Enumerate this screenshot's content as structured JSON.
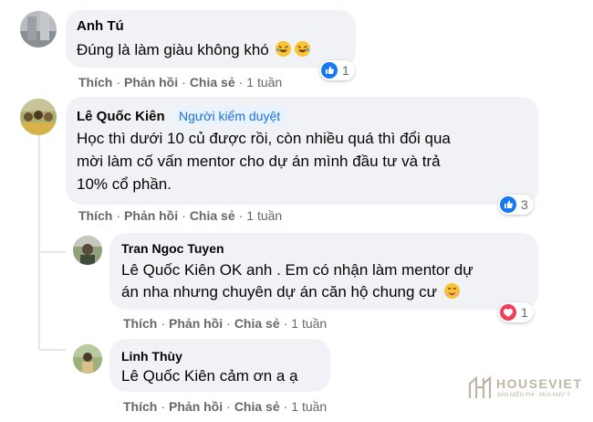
{
  "comments": [
    {
      "author": "Anh Tú",
      "text": "Đúng là làm giàu không khó",
      "reaction_count": "1",
      "actions": {
        "like": "Thích",
        "reply": "Phản hồi",
        "share": "Chia sẻ",
        "time": "1 tuần"
      }
    },
    {
      "author": "Lê Quốc Kiên",
      "badge": "Người kiểm duyệt",
      "lines": [
        "Học thì dưới 10 củ được rồi, còn nhiều quá thì đổi qua",
        "mời làm cố vấn mentor cho dự án mình đầu tư và trả",
        "10% cổ phần."
      ],
      "reaction_count": "3",
      "actions": {
        "like": "Thích",
        "reply": "Phản hồi",
        "share": "Chia sẻ",
        "time": "1 tuần"
      }
    }
  ],
  "replies": [
    {
      "author": "Tran Ngoc Tuyen",
      "mention": "Lê Quốc Kiên",
      "line1": " OK anh . Em có nhận làm mentor dự",
      "line2": "án nha nhưng chuyên dự án căn hộ chung cư",
      "reaction_count": "1",
      "actions": {
        "like": "Thích",
        "reply": "Phản hồi",
        "share": "Chia sẻ",
        "time": "1 tuần"
      }
    },
    {
      "author": "Linh Thùy",
      "mention": "Lê Quốc Kiên",
      "line1": " cảm ơn a ạ",
      "actions": {
        "like": "Thích",
        "reply": "Phản hồi",
        "share": "Chia sẻ",
        "time": "1 tuần"
      }
    }
  ],
  "watermark": {
    "brand": "HOUSEVIET",
    "tagline": "BÁN MIỄN PHÍ · MUA NHƯ Ý"
  },
  "icons": [
    "like-reaction-icon",
    "heart-reaction-icon",
    "laughing-emoji-icon",
    "smiling-emoji-icon"
  ],
  "colors": {
    "bubble": "#f0f2f5",
    "badge_bg": "#e7f3ff",
    "badge_text": "#216fdb",
    "like": "#1877f2",
    "heart": "#f33e58",
    "meta": "#65676b"
  }
}
